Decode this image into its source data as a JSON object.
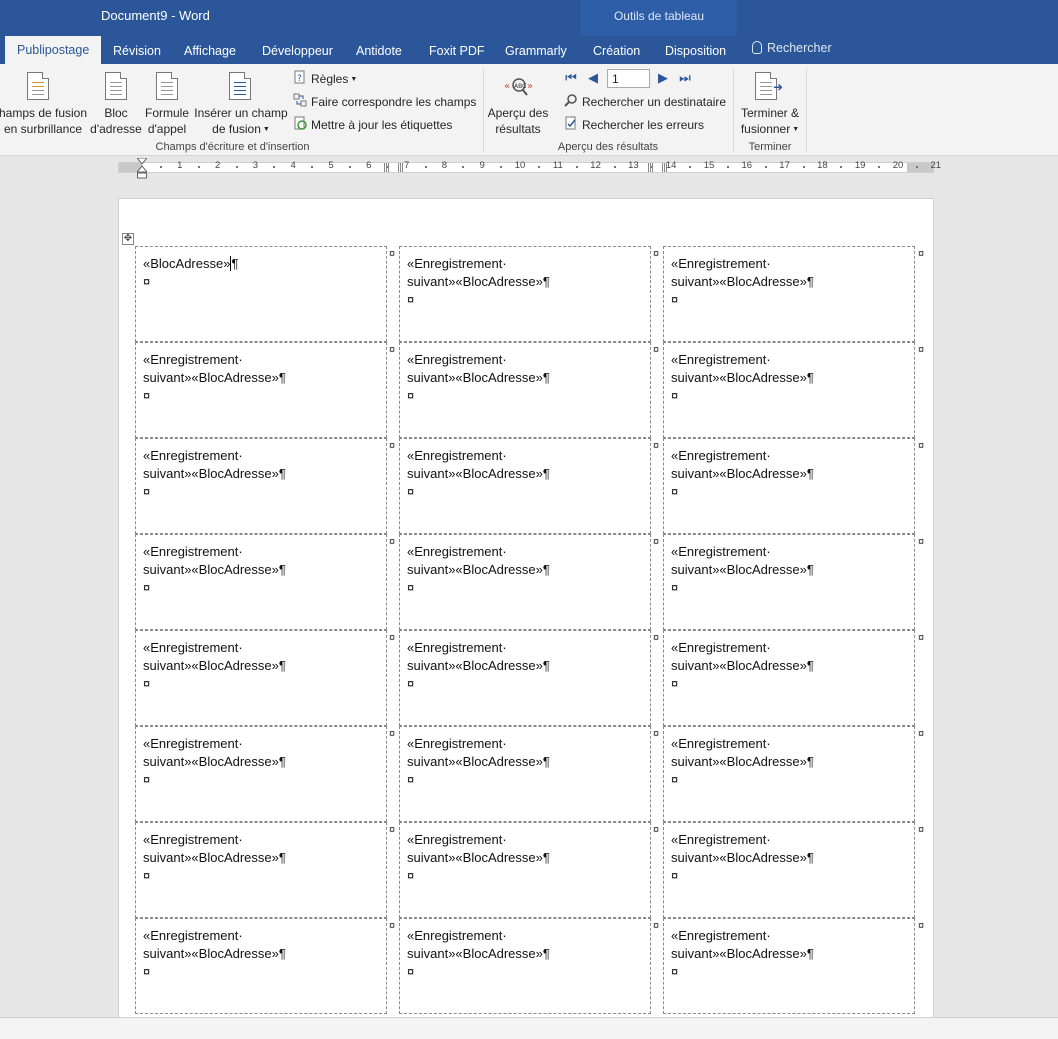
{
  "window": {
    "title": "Document9  -  Word"
  },
  "context_tab_group": "Outils de tableau",
  "tabs": [
    {
      "label": "Publipostage"
    },
    {
      "label": "Révision"
    },
    {
      "label": "Affichage"
    },
    {
      "label": "Développeur"
    },
    {
      "label": "Antidote"
    },
    {
      "label": "Foxit PDF"
    },
    {
      "label": "Grammarly"
    },
    {
      "label": "Création"
    },
    {
      "label": "Disposition"
    }
  ],
  "tell_me": "Rechercher",
  "ribbon": {
    "champs_fusion": "hamps de fusion\nen surbrillance",
    "bloc_adresse": "Bloc\nd'adresse",
    "formule_appel": "Formule\nd'appel",
    "inserer_champ": "Insérer un champ\nde fusion",
    "regles": "Règles",
    "faire_correspondre": "Faire correspondre les champs",
    "mettre_a_jour": "Mettre à jour les étiquettes",
    "group_champs": "Champs d'écriture et d'insertion",
    "apercu_resultats": "Aperçu des\nrésultats",
    "record_value": "1",
    "rechercher_destinataire": "Rechercher un destinataire",
    "rechercher_erreurs": "Rechercher les erreurs",
    "group_apercu": "Aperçu des résultats",
    "terminer_fusionner": "Terminer &\nfusionner",
    "group_terminer": "Terminer"
  },
  "ruler": {
    "numbers": [
      "1",
      "2",
      "3",
      "4",
      "5",
      "6",
      "7",
      "8",
      "9",
      "10",
      "11",
      "12",
      "13",
      "14",
      "15",
      "16",
      "17",
      "18",
      "19",
      "20",
      "21"
    ]
  },
  "labels": {
    "first": "«BlocAdresse»",
    "next_line1": "«Enregistrement·",
    "next_line2": "suivant»«BlocAdresse»¶",
    "pilcrow": "¶",
    "cell_end": "¤",
    "rows": 8,
    "cols": 3
  }
}
